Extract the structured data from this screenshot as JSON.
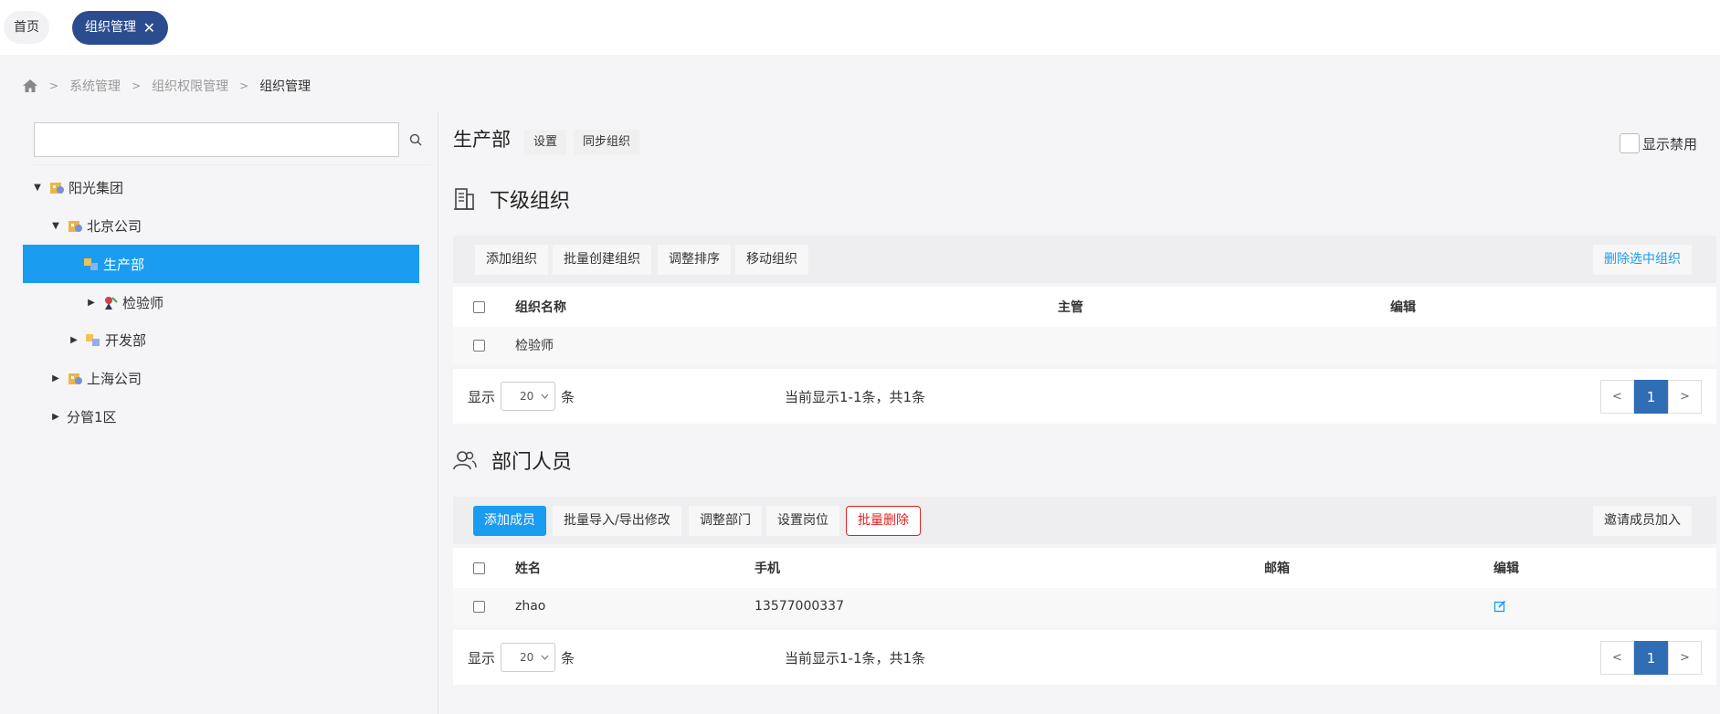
{
  "tabs": {
    "home": "首页",
    "active": "组织管理",
    "close": "✕"
  },
  "breadcrumb": {
    "items": [
      "系统管理",
      "组织权限管理",
      "组织管理"
    ]
  },
  "tree": {
    "search_placeholder": "",
    "nodes": [
      {
        "label": "阳光集团",
        "expanded": true
      },
      {
        "label": "北京公司",
        "expanded": true
      },
      {
        "label": "生产部",
        "selected": true
      },
      {
        "label": "检验师",
        "expanded": false
      },
      {
        "label": "开发部",
        "expanded": false
      },
      {
        "label": "上海公司",
        "expanded": false
      },
      {
        "label": "分管1区",
        "expanded": false
      }
    ]
  },
  "dept": {
    "name": "生产部",
    "settings_label": "设置",
    "sync_label": "同步组织",
    "show_disabled_label": "显示禁用"
  },
  "sub_orgs": {
    "title": "下级组织",
    "toolbar": {
      "add": "添加组织",
      "batch_create": "批量创建组织",
      "reorder": "调整排序",
      "move": "移动组织",
      "delete_selected": "删除选中组织"
    },
    "columns": [
      "组织名称",
      "主管",
      "编辑"
    ],
    "rows": [
      {
        "name": "检验师",
        "manager": "",
        "edit": ""
      }
    ],
    "pager": {
      "show_label": "显示",
      "page_size": "20",
      "unit_label": "条",
      "info": "当前显示1-1条，共1条",
      "prev": "<",
      "current": "1",
      "next": ">"
    }
  },
  "members": {
    "title": "部门人员",
    "toolbar": {
      "add": "添加成员",
      "batch_import": "批量导入/导出修改",
      "adjust_dept": "调整部门",
      "set_post": "设置岗位",
      "batch_delete": "批量删除",
      "invite": "邀请成员加入"
    },
    "columns": [
      "姓名",
      "手机",
      "邮箱",
      "编辑"
    ],
    "rows": [
      {
        "name": "zhao",
        "phone": "13577000337",
        "email": ""
      }
    ],
    "pager": {
      "show_label": "显示",
      "page_size": "20",
      "unit_label": "条",
      "info": "当前显示1-1条，共1条",
      "prev": "<",
      "current": "1",
      "next": ">"
    }
  },
  "colors": {
    "tab_active": "#2b4d8f",
    "selection": "#1a9cf0",
    "danger": "#e02020",
    "pager_active": "#2f6db4"
  }
}
